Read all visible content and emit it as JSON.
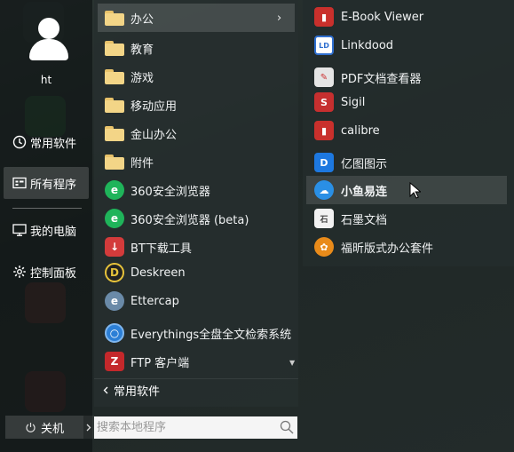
{
  "sidebar": {
    "username": "ht",
    "items": [
      {
        "label": "常用软件",
        "icon": "clock-icon"
      },
      {
        "label": "所有程序",
        "icon": "apps-icon"
      },
      {
        "label": "我的电脑",
        "icon": "monitor-icon"
      },
      {
        "label": "控制面板",
        "icon": "gear-icon"
      }
    ],
    "shutdown_label": "关机"
  },
  "apps": [
    {
      "label": "办公",
      "icon": "folder-icon"
    },
    {
      "label": "教育",
      "icon": "folder-icon"
    },
    {
      "label": "游戏",
      "icon": "folder-icon"
    },
    {
      "label": "移动应用",
      "icon": "folder-icon"
    },
    {
      "label": "金山办公",
      "icon": "folder-icon"
    },
    {
      "label": "附件",
      "icon": "folder-icon"
    },
    {
      "label": "360安全浏览器",
      "icon": "360-browser-icon",
      "color": "#1fb45a"
    },
    {
      "label": "360安全浏览器 (beta)",
      "icon": "360-browser-beta-icon",
      "color": "#1fb45a"
    },
    {
      "label": "BT下载工具",
      "icon": "bt-download-icon",
      "color": "#d33b3b"
    },
    {
      "label": "Deskreen",
      "icon": "deskreen-icon",
      "color": "#222222"
    },
    {
      "label": "Ettercap",
      "icon": "ettercap-icon",
      "color": "#6a8aa8"
    },
    {
      "label": "Everythings全盘全文检索系统",
      "icon": "everything-search-icon",
      "color": "#2c7fd6"
    },
    {
      "label": "FTP 客户端",
      "icon": "filezilla-icon",
      "color": "#c4282b"
    }
  ],
  "back_label": "常用软件",
  "search": {
    "placeholder": "搜索本地程序"
  },
  "submenu": [
    {
      "label": "E-Book Viewer",
      "icon": "ebook-viewer-icon",
      "color": "#c9302c"
    },
    {
      "label": "Linkdood",
      "icon": "linkdood-icon",
      "color": "#2f6fd0"
    },
    {
      "label": "PDF文档查看器",
      "icon": "pdf-viewer-icon",
      "color": "#e5e5e5"
    },
    {
      "label": "Sigil",
      "icon": "sigil-icon",
      "color": "#c62f2f"
    },
    {
      "label": "calibre",
      "icon": "calibre-icon",
      "color": "#c9302c"
    },
    {
      "label": "亿图图示",
      "icon": "edraw-icon",
      "color": "#1d78e0"
    },
    {
      "label": "小鱼易连",
      "icon": "xiaoyu-icon",
      "color": "#2a8fe5"
    },
    {
      "label": "石墨文档",
      "icon": "shimo-icon",
      "color": "#f2f2f2"
    },
    {
      "label": "福昕版式办公套件",
      "icon": "foxit-suite-icon",
      "color": "#e98b1a"
    }
  ]
}
